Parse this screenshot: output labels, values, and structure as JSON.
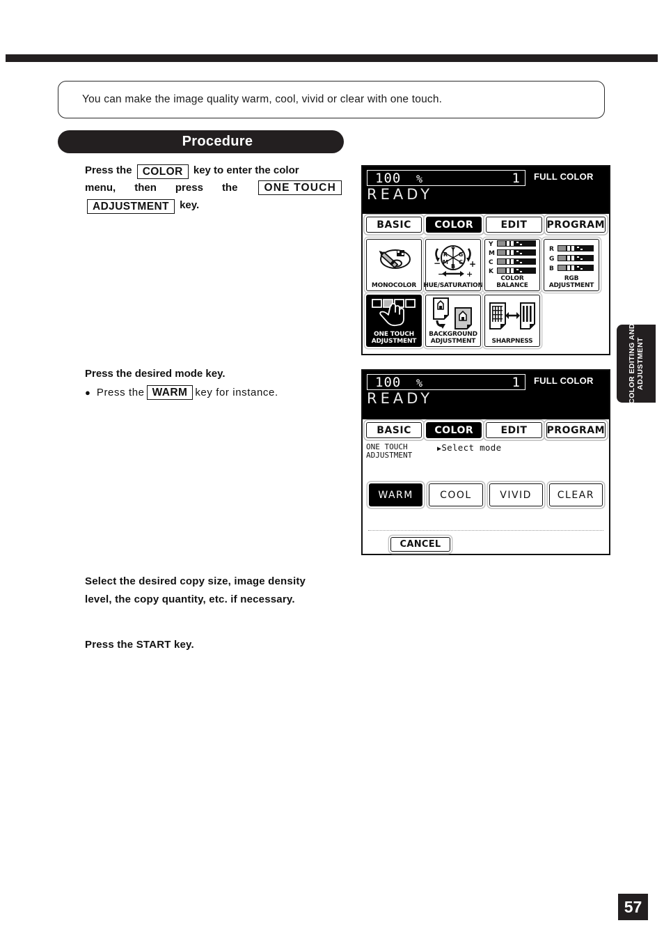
{
  "intro": {
    "text": "You can make the image quality warm, cool, vivid or clear with one touch."
  },
  "section": {
    "title": "Procedure"
  },
  "steps": {
    "step1": {
      "l1a": "Press the",
      "l1key": "COLOR",
      "l1b": "key to enter the color",
      "l2a": "menu,",
      "l2b": "then",
      "l2c": "press",
      "l2d": "the",
      "l2key": "ONE  TOUCH",
      "l3key": "ADJUSTMENT",
      "l3b": "key."
    },
    "step2": {
      "heading": "Press the desired mode key.",
      "bullet_a": "Press the",
      "bullet_key": "WARM",
      "bullet_b": "key for instance."
    },
    "step3": {
      "l1": "Select the desired copy size, image density",
      "l2": "level,  the copy quantity, etc. if necessary."
    },
    "step4": {
      "l1": "Press the START key."
    }
  },
  "lcd1": {
    "zoom": "100",
    "percent": "%",
    "quantity": "1",
    "color_mode": "FULL COLOR",
    "status": "READY",
    "tabs": [
      {
        "label": "BASIC",
        "selected": false
      },
      {
        "label": "COLOR",
        "selected": true
      },
      {
        "label": "EDIT",
        "selected": false
      },
      {
        "label": "PROGRAM",
        "selected": false
      }
    ],
    "cells": [
      {
        "label": "MONOCOLOR",
        "icon": "palette-brush-icon",
        "selected": false
      },
      {
        "label": "HUE/SATURATION",
        "icon": "hue-wheel-icon",
        "selected": false
      },
      {
        "label": "COLOR BALANCE",
        "icon": "ymck-bars-icon",
        "selected": false
      },
      {
        "label": "RGB\nADJUSTMENT",
        "icon": "rgb-bars-icon",
        "selected": false
      },
      {
        "label": "ONE TOUCH\nADJUSTMENT",
        "icon": "finger-press-icon",
        "selected": true
      },
      {
        "label": "BACKGROUND\nADJUSTMENT",
        "icon": "two-pages-icon",
        "selected": false
      },
      {
        "label": "SHARPNESS",
        "icon": "sharpness-pages-icon",
        "selected": false
      }
    ],
    "cell_labels": {
      "monocolor": "MONOCOLOR",
      "hue_saturation": "HUE/SATURATION",
      "color_balance": "COLOR BALANCE",
      "rgb_adjustment_1": "RGB",
      "rgb_adjustment_2": "ADJUSTMENT",
      "one_touch_1": "ONE TOUCH",
      "one_touch_2": "ADJUSTMENT",
      "background_1": "BACKGROUND",
      "background_2": "ADJUSTMENT",
      "sharpness": "SHARPNESS"
    },
    "balance_rows": [
      "Y",
      "M",
      "C",
      "K"
    ],
    "rgb_rows": [
      "R",
      "G",
      "B"
    ],
    "hue_wheel": [
      "Y",
      "G",
      "C",
      "B",
      "M",
      "R"
    ],
    "hue_signs": {
      "minus": "−",
      "plus": "+"
    }
  },
  "lcd2": {
    "zoom": "100",
    "percent": "%",
    "quantity": "1",
    "color_mode": "FULL COLOR",
    "status": "READY",
    "tabs": [
      {
        "label": "BASIC",
        "selected": false
      },
      {
        "label": "COLOR",
        "selected": true
      },
      {
        "label": "EDIT",
        "selected": false
      },
      {
        "label": "PROGRAM",
        "selected": false
      }
    ],
    "mode_title_1": "ONE TOUCH",
    "mode_title_2": "ADJUSTMENT",
    "prompt": "Select mode",
    "modes": [
      {
        "label": "WARM",
        "selected": true
      },
      {
        "label": "COOL",
        "selected": false
      },
      {
        "label": "VIVID",
        "selected": false
      },
      {
        "label": "CLEAR",
        "selected": false
      }
    ],
    "cancel_label": "CANCEL"
  },
  "side_tab": {
    "line1": "COLOR EDITING AND",
    "line2": "ADJUSTMENT"
  },
  "page_number": "57",
  "colors": {
    "ink": "#231f20",
    "paper": "#ffffff"
  }
}
